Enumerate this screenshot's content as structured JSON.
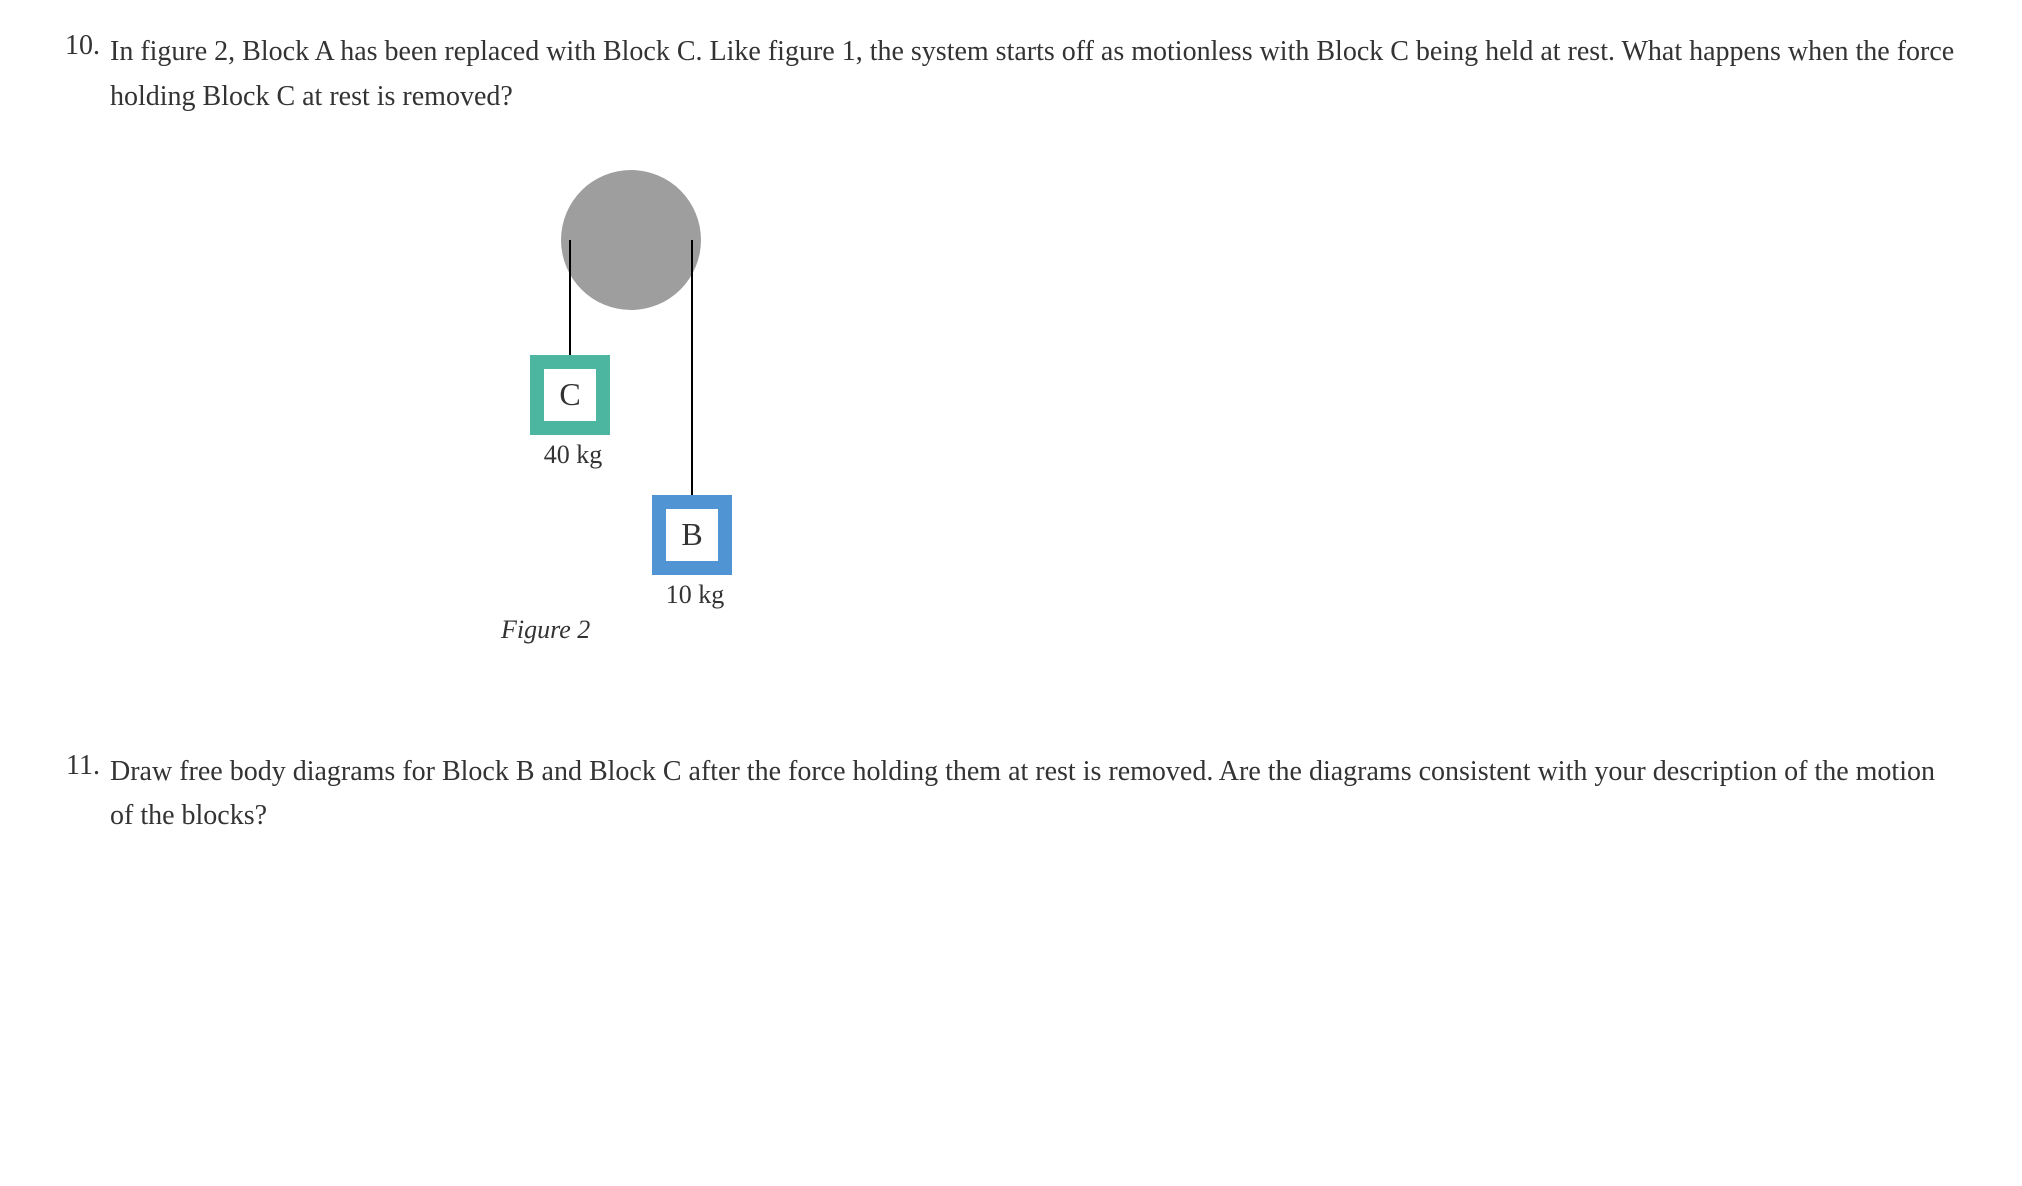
{
  "questions": {
    "q10": {
      "number": "10.",
      "text": "In figure 2, Block A has been replaced with Block C. Like figure 1, the system starts off as motionless with Block C being held at rest. What happens when the force holding Block C at rest is removed?"
    },
    "q11": {
      "number": "11.",
      "text": "Draw free body diagrams for Block B and Block C after the force holding them at rest is removed. Are the diagrams consistent with your description of the motion of the blocks?"
    }
  },
  "figure": {
    "caption": "Figure 2",
    "blockC": {
      "label": "C",
      "mass": "40 kg"
    },
    "blockB": {
      "label": "B",
      "mass": "10 kg"
    }
  }
}
